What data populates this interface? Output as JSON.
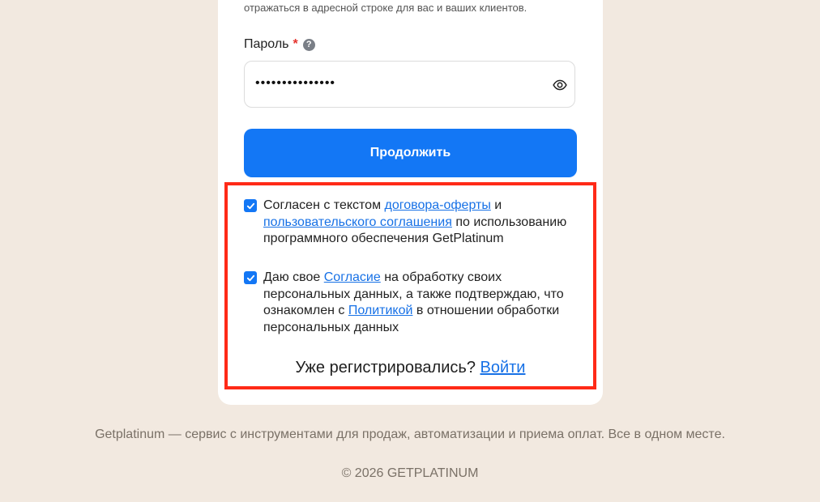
{
  "domain_hint": "Hint text above password field",
  "form": {
    "domain_hint": "отражаться в адресной строке для вас и ваших клиентов.",
    "password_label": "Пароль",
    "required_mark": "*",
    "help_symbol": "?",
    "password_value": "•••••••••••••••",
    "continue_label": "Продолжить"
  },
  "consent": {
    "first": {
      "checked": true,
      "prefix": "Согласен с текстом ",
      "link1": "договора-оферты",
      "middle": " и ",
      "link2": "пользовательского соглашения",
      "suffix": " по использованию программного обеспечения GetPlatinum"
    },
    "second": {
      "checked": true,
      "prefix": "Даю свое ",
      "link1": "Согласие",
      "middle": " на обработку своих персональных данных, а также подтверждаю, что ознакомлен с ",
      "link2": "Политикой",
      "suffix": " в отношении обработки персональных данных"
    }
  },
  "login_prompt": {
    "text": "Уже регистрировались? ",
    "link": "Войти"
  },
  "footer": {
    "tagline": "Getplatinum — сервис с инструментами для продаж, автоматизации и приема оплат. Все в одном месте.",
    "copyright": "© 2026 GETPLATINUM"
  },
  "colors": {
    "accent": "#1377f5",
    "highlight_border": "#ff2a17",
    "background": "#f2e9e0"
  }
}
